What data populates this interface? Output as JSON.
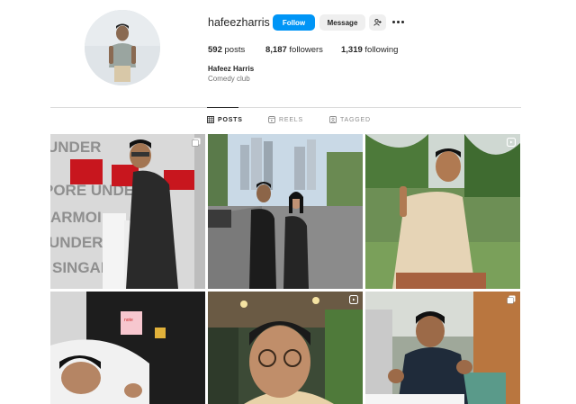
{
  "profile": {
    "username": "hafeezharris",
    "full_name": "Hafeez Harris",
    "category": "Comedy club"
  },
  "actions": {
    "follow_label": "Follow",
    "message_label": "Message",
    "suggest_icon": "person-add-icon",
    "more_icon": "more-dots-icon"
  },
  "stats": {
    "posts_count": "592",
    "posts_label": "posts",
    "followers_count": "8,187",
    "followers_label": "followers",
    "following_count": "1,319",
    "following_label": "following"
  },
  "tabs": [
    {
      "label": "POSTS",
      "icon": "grid-icon",
      "active": true
    },
    {
      "label": "REELS",
      "icon": "reels-icon",
      "active": false
    },
    {
      "label": "TAGGED",
      "icon": "tag-icon",
      "active": false
    }
  ],
  "colors": {
    "accent": "#0095f6",
    "button_secondary": "#efefef",
    "text": "#262626",
    "muted": "#737373"
  },
  "posts": [
    {
      "badge": "multiple-icon",
      "scene": "man with shopping bags in front of store wall"
    },
    {
      "badge": "",
      "scene": "couple standing on city street"
    },
    {
      "badge": "reel-icon",
      "scene": "man in beige shirt outdoors"
    },
    {
      "badge": "",
      "scene": "man lying with note on jacket"
    },
    {
      "badge": "reel-icon",
      "scene": "man with glasses close-up"
    },
    {
      "badge": "multiple-icon",
      "scene": "man gesturing at stall"
    }
  ]
}
